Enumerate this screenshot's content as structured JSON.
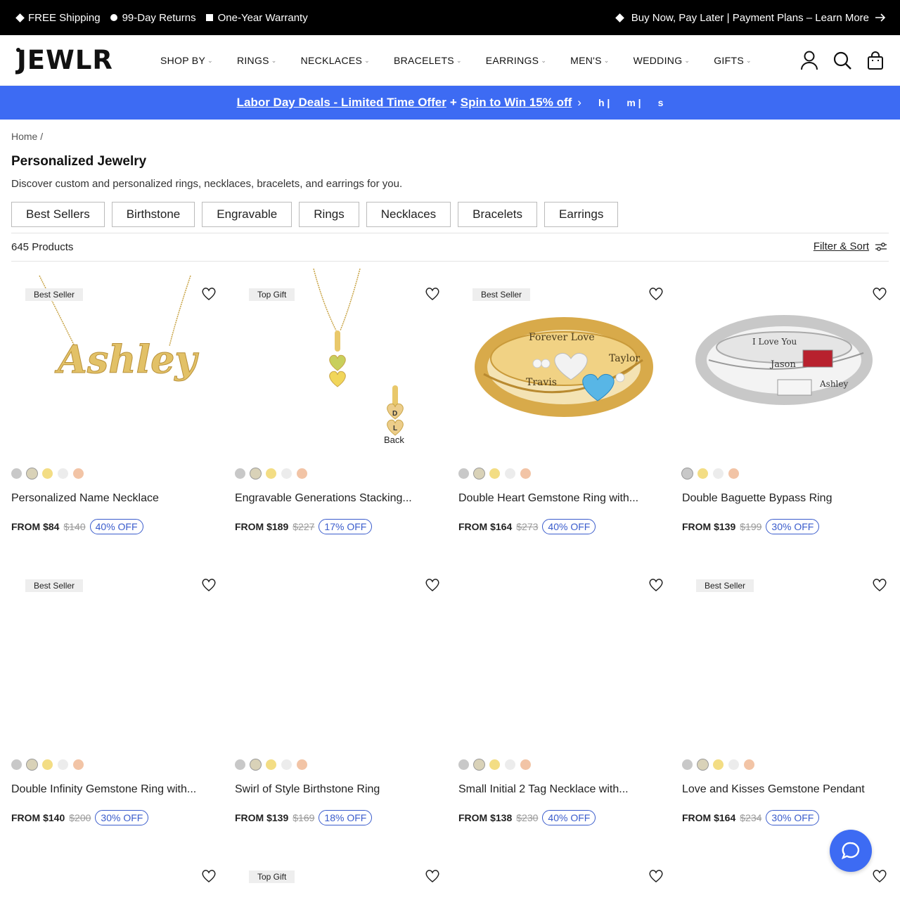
{
  "topbar": {
    "free_shipping": "FREE Shipping",
    "returns": "99-Day Returns",
    "warranty": "One-Year Warranty",
    "payment": "Buy Now, Pay Later | Payment Plans – Learn More"
  },
  "header": {
    "logo": "JEWLR",
    "nav": [
      "SHOP BY",
      "RINGS",
      "NECKLACES",
      "BRACELETS",
      "EARRINGS",
      "MEN'S",
      "WEDDING",
      "GIFTS"
    ]
  },
  "banner": {
    "deal": "Labor Day Deals - Limited Time Offer",
    "plus": "+",
    "spin": "Spin to Win 15% off",
    "arrow": "›",
    "timer_h": "h |",
    "timer_m": "m |",
    "timer_s": "s"
  },
  "breadcrumb": "Home /",
  "page_title": "Personalized Jewelry",
  "page_desc": "Discover custom and personalized rings, necklaces, bracelets, and earrings for you.",
  "chips": [
    "Best Sellers",
    "Birthstone",
    "Engravable",
    "Rings",
    "Necklaces",
    "Bracelets",
    "Earrings"
  ],
  "product_count": "645 Products",
  "filter_label": "Filter & Sort",
  "back_label": "Back",
  "swatch_colors": {
    "silver": "#c8c8c8",
    "twotone": "#d9d2b8",
    "gold": "#f3dd84",
    "white": "#ececec",
    "rose": "#f2c4a6"
  },
  "products": [
    {
      "badge": "Best Seller",
      "name": "Personalized Name Necklace",
      "price": "FROM $84",
      "was": "$140",
      "off": "40% OFF"
    },
    {
      "badge": "Top Gift",
      "name": "Engravable Generations Stacking...",
      "price": "FROM $189",
      "was": "$227",
      "off": "17% OFF"
    },
    {
      "badge": "Best Seller",
      "name": "Double Heart Gemstone Ring with...",
      "price": "FROM $164",
      "was": "$273",
      "off": "40% OFF"
    },
    {
      "badge": "",
      "name": "Double Baguette Bypass Ring",
      "price": "FROM $139",
      "was": "$199",
      "off": "30% OFF"
    },
    {
      "badge": "Best Seller",
      "name": "Double Infinity Gemstone Ring with...",
      "price": "FROM $140",
      "was": "$200",
      "off": "30% OFF"
    },
    {
      "badge": "",
      "name": "Swirl of Style Birthstone Ring",
      "price": "FROM $139",
      "was": "$169",
      "off": "18% OFF"
    },
    {
      "badge": "",
      "name": "Small Initial 2 Tag Necklace with...",
      "price": "FROM $138",
      "was": "$230",
      "off": "40% OFF"
    },
    {
      "badge": "Best Seller",
      "name": "Love and Kisses Gemstone Pendant",
      "price": "FROM $164",
      "was": "$234",
      "off": "30% OFF"
    },
    {
      "badge": "",
      "name": "",
      "price": "",
      "was": "",
      "off": ""
    },
    {
      "badge": "Top Gift",
      "name": "",
      "price": "",
      "was": "",
      "off": ""
    }
  ],
  "necklace_text": "Ashley",
  "ring3_text": {
    "top": "Forever Love",
    "left": "Travis",
    "right": "Taylor"
  },
  "ring4_text": {
    "top": "I Love You",
    "mid": "Jason",
    "bottom": "Ashley"
  },
  "pendant_letters": [
    "D",
    "L"
  ]
}
